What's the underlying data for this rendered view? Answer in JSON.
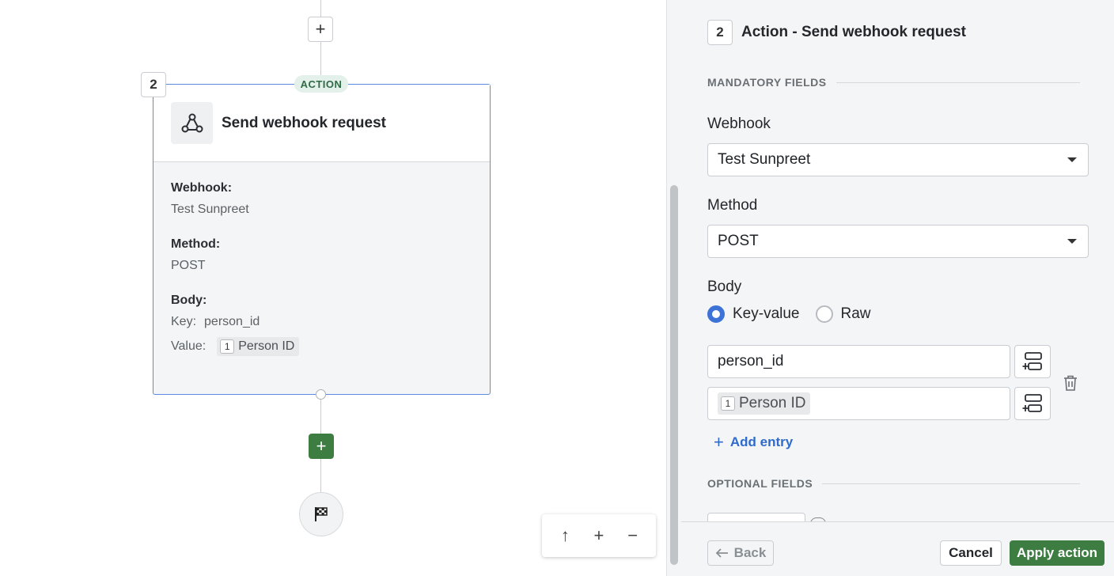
{
  "canvas": {
    "step_number": "2",
    "action_tag": "ACTION",
    "node_title": "Send webhook request",
    "webhook_label": "Webhook:",
    "webhook_value": "Test Sunpreet",
    "method_label": "Method:",
    "method_value": "POST",
    "body_label": "Body:",
    "key_label": "Key:",
    "key_value": "person_id",
    "value_label": "Value:",
    "value_chip_num": "1",
    "value_chip_text": "Person ID",
    "add_symbol": "+",
    "zoom_controls": {
      "up": "↑",
      "zoom_in": "+",
      "zoom_out": "−"
    }
  },
  "panel": {
    "step_number": "2",
    "title": "Action - Send webhook request",
    "mandatory_section": "MANDATORY FIELDS",
    "webhook_label": "Webhook",
    "webhook_value": "Test Sunpreet",
    "method_label": "Method",
    "method_value": "POST",
    "body_label": "Body",
    "body_options": [
      "Key-value",
      "Raw"
    ],
    "body_selected": "Key-value",
    "entry_key": "person_id",
    "entry_value_num": "1",
    "entry_value_text": "Person ID",
    "add_entry": "Add entry",
    "optional_section": "OPTIONAL FIELDS"
  },
  "footer": {
    "back": "Back",
    "cancel": "Cancel",
    "apply": "Apply action"
  },
  "colors": {
    "accent_blue": "#3d73d6",
    "primary_green": "#3e7d42",
    "action_tag_bg": "#e3f1ea"
  }
}
